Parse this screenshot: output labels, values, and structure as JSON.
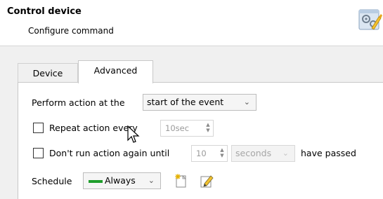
{
  "header": {
    "title": "Control device",
    "subtitle": "Configure command",
    "icon": "settings-wizard-icon"
  },
  "tabs": [
    {
      "label": "Device",
      "active": false
    },
    {
      "label": "Advanced",
      "active": true
    }
  ],
  "perform_action": {
    "label": "Perform action at the",
    "selected": "start of the event"
  },
  "repeat_action": {
    "label": "Repeat action every",
    "checked": false,
    "value": "10sec"
  },
  "dont_run_again": {
    "label": "Don't run action again until",
    "checked": false,
    "value": "10",
    "unit": "seconds",
    "suffix": "have passed"
  },
  "schedule": {
    "label": "Schedule",
    "selected": "Always",
    "color": "#1f9e2c",
    "new_icon": "new-schedule-icon",
    "edit_icon": "edit-schedule-icon"
  }
}
